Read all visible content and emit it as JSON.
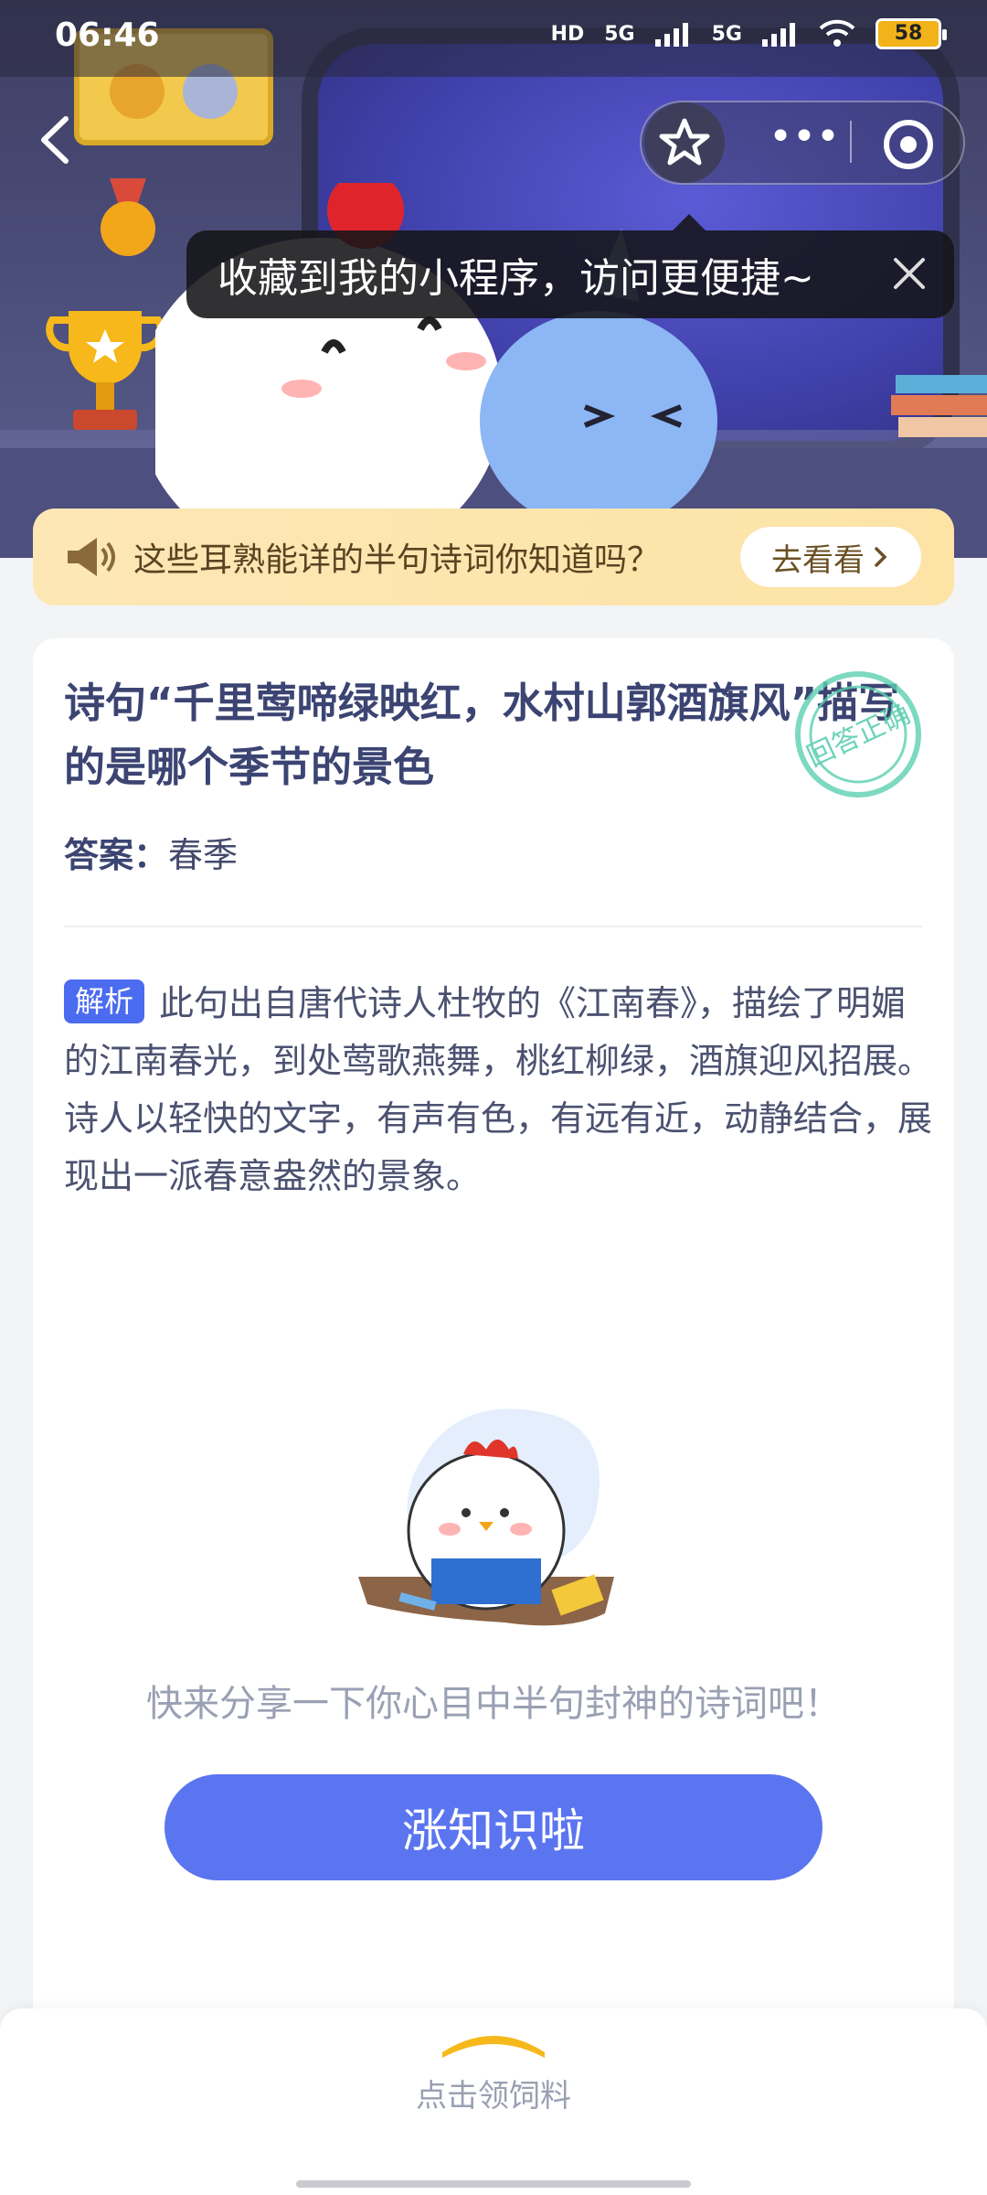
{
  "status_bar": {
    "time": "06:46",
    "network_1": "5G",
    "network_2": "5G",
    "battery": "58"
  },
  "miniprogram": {
    "tooltip": "收藏到我的小程序，访问更便捷~"
  },
  "banner": {
    "text": "这些耳熟能详的半句诗词你知道吗？",
    "button": "去看看"
  },
  "question": {
    "title": "诗句“千里莺啼绿映红，水村山郭酒旗风”描写的是哪个季节的景色",
    "answer_label": "答案：",
    "answer_value": "春季",
    "stamp_text": "回答正确",
    "analysis_tag": "解析",
    "analysis_text": "此句出自唐代诗人杜牧的《江南春》，描绘了明媚的江南春光，到处莺歌燕舞，桃红柳绿，酒旗迎风招展。诗人以轻快的文字，有声有色，有远有近，动静结合，展现出一派春意盎然的景象。"
  },
  "share": {
    "prompt": "快来分享一下你心目中半句封神的诗词吧！",
    "button": "涨知识啦"
  },
  "bottom": {
    "label": "点击领饲料"
  },
  "colors": {
    "primary": "#5b75f0",
    "title": "#3b4472",
    "banner_bg": "#fde3a6",
    "stamp": "#5ccfb0"
  }
}
